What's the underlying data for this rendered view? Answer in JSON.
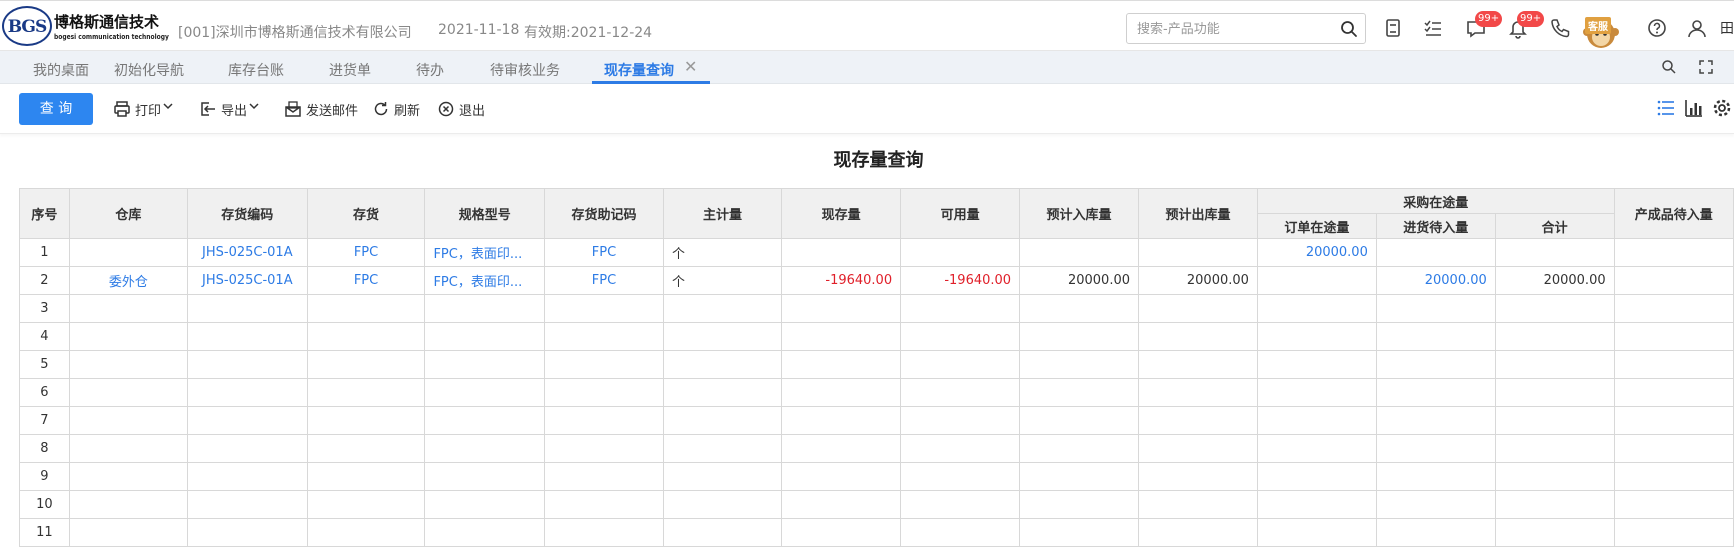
{
  "header": {
    "logo_mark": "BGS",
    "logo_name": "博格斯通信技术",
    "logo_en": "bogesi communication technology",
    "company": "[001]深圳市博格斯通信技术有限公司",
    "date": "2021-11-18",
    "expiry": "有效期:2021-12-24",
    "search_placeholder": "搜索-产品功能",
    "message_badge": "99+",
    "notice_badge": "99+",
    "service_label": "客服",
    "edge_glyph": "田"
  },
  "tabs": [
    {
      "label": "我的桌面"
    },
    {
      "label": "初始化导航"
    },
    {
      "label": "库存台账"
    },
    {
      "label": "进货单"
    },
    {
      "label": "待办"
    },
    {
      "label": "待审核业务"
    },
    {
      "label": "现存量查询",
      "active": true,
      "close": "✕"
    }
  ],
  "toolbar": {
    "query": "查 询",
    "print": "打印",
    "export": "导出",
    "email": "发送邮件",
    "refresh": "刷新",
    "exit": "退出"
  },
  "report": {
    "title": "现存量查询",
    "columns": {
      "seq": "序号",
      "warehouse": "仓库",
      "code": "存货编码",
      "item": "存货",
      "spec": "规格型号",
      "mnemonic": "存货助记码",
      "unit": "主计量",
      "onhand": "现存量",
      "available": "可用量",
      "pre_in": "预计入库量",
      "pre_out": "预计出库量",
      "purchase_group": "采购在途量",
      "order_transit": "订单在途量",
      "receipt_pending": "进货待入量",
      "total": "合计",
      "product_pending": "产成品待入量"
    },
    "rows": [
      {
        "seq": "1",
        "warehouse": "",
        "code": "JHS-025C-01A",
        "item": "FPC",
        "spec": "FPC，表面印...",
        "mnemonic": "FPC",
        "unit": "个",
        "onhand": "",
        "available": "",
        "pre_in": "",
        "pre_out": "",
        "order_transit": "20000.00",
        "receipt_pending": "",
        "total": "",
        "product_pending": ""
      },
      {
        "seq": "2",
        "warehouse": "委外仓",
        "code": "JHS-025C-01A",
        "item": "FPC",
        "spec": "FPC，表面印...",
        "mnemonic": "FPC",
        "unit": "个",
        "onhand": "-19640.00",
        "available": "-19640.00",
        "pre_in": "20000.00",
        "pre_out": "20000.00",
        "order_transit": "",
        "receipt_pending": "20000.00",
        "total": "20000.00",
        "product_pending": ""
      },
      {
        "seq": "3"
      },
      {
        "seq": "4"
      },
      {
        "seq": "5"
      },
      {
        "seq": "6"
      },
      {
        "seq": "7"
      },
      {
        "seq": "8"
      },
      {
        "seq": "9"
      },
      {
        "seq": "10"
      },
      {
        "seq": "11"
      }
    ]
  }
}
